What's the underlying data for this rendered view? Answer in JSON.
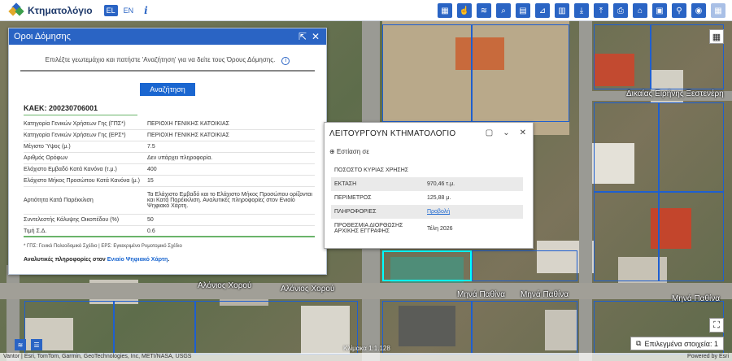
{
  "header": {
    "app_title": "Κτηματολόγιο",
    "languages": [
      "EL",
      "EN"
    ],
    "active_language": "EL",
    "info_label": "i",
    "brand_color": "#2a64c4",
    "tools": [
      "grid-icon",
      "touch-icon",
      "layers-icon",
      "search-icon",
      "print-icon",
      "measure-icon",
      "calculator-icon",
      "download-icon",
      "upload-icon",
      "printer-icon",
      "bank-icon",
      "map-book-icon",
      "pin-icon",
      "location-icon",
      "building-icon"
    ]
  },
  "panel": {
    "title": "Οροι Δόμησης",
    "hint": "Επιλέξτε γεωτεμάχιο και πατήστε 'Αναζήτηση' για να δείτε τους Όρους Δόμησης.",
    "search_label": "Αναζήτηση",
    "kaek": "ΚΑΕΚ: 200230706001",
    "rows": [
      {
        "k": "Κατηγορία Γενικών Χρήσεων Γης (ΓΠΣ*)",
        "v": "ΠΕΡΙΟΧΗ ΓΕΝΙΚΗΣ ΚΑΤΟΙΚΙΑΣ"
      },
      {
        "k": "Κατηγορία Γενικών Χρήσεων Γης (ΕΡΣ*)",
        "v": "ΠΕΡΙΟΧΗ ΓΕΝΙΚΗΣ ΚΑΤΟΙΚΙΑΣ"
      },
      {
        "k": "Μέγιστο Ύψος (μ.)",
        "v": "7.5"
      },
      {
        "k": "Αριθμός Ορόφων",
        "v": "Δεν υπάρχει πληροφορία."
      },
      {
        "k": "Ελάχιστο Εμβαδό Κατά Κανόνα (τ.μ.)",
        "v": "400"
      },
      {
        "k": "Ελάχιστο Μήκος Προσώπου Κατά Κανόνα (μ.)",
        "v": "15"
      },
      {
        "k": "Αρτιότητα Κατά Παρέκκλιση",
        "v": "Τα Ελάχιστο Εμβαδό και το Ελάχιστο Μήκος Προσώπου ορίζονται και Κατά Παρέκκλιση. Αναλυτικές πληροφορίες στον Ενιαίο Ψηφιακό Χάρτη."
      },
      {
        "k": "Συντελεστής Κάλυψης Οικοπέδου (%)",
        "v": "50"
      },
      {
        "k": "Τιμή Σ.Δ.",
        "v": "0.6"
      }
    ],
    "footnote": "* ΓΠΣ: Γενικό Πολεοδομικό Σχέδιο | ΕΡΣ: Εγκεκριμένο Ρυμοτομικό Σχέδιο",
    "more_prefix": "Αναλυτικές πληροφορίες στον ",
    "more_link": "Ενιαίο Ψηφιακό Χάρτη",
    "more_suffix": "."
  },
  "popup": {
    "title": "ΛΕΙΤΟΥΡΓΟΥΝ ΚΤΗΜΑΤΟΛΟΓΙΟ",
    "zoom_label": "Εστίαση σε",
    "rows": [
      {
        "k": "ΠΟΣΟΣΤΟ ΚΥΡΙΑΣ ΧΡΗΣΗΣ",
        "v": ""
      },
      {
        "k": "ΕΚΤΑΣΗ",
        "v": "970,46 τ.μ."
      },
      {
        "k": "ΠΕΡΙΜΕΤΡΟΣ",
        "v": "125,88 μ."
      },
      {
        "k": "ΠΛΗΡΟΦΟΡΙΕΣ",
        "v": "Προβολή"
      },
      {
        "k": "ΠΡΟΘΕΣΜΙΑ ΔΙΟΡΘΩΣΗΣ ΑΡΧΙΚΗΣ ΕΓΓΡΑΦΗΣ",
        "v": "Τέλη 2026"
      }
    ]
  },
  "map": {
    "streets": [
      "Δικαίας Ειρήνης Ξεστενέρη",
      "Αλόνιος Χορού",
      "Αλόνιος Χορού",
      "Μηνά Παθίνα",
      "Μηνά Παθίνα",
      "Μηνά Παθίνα"
    ],
    "attribution": "Vantor | Esri, TomTom, Garmin, GeoTechnologies, Inc, METI/NASA, USGS",
    "powered_by": "Powered by Esri",
    "selected_label": "Επιλεγμένα στοιχεία: 1",
    "scale": "Κλίμακα 1:1.128"
  }
}
